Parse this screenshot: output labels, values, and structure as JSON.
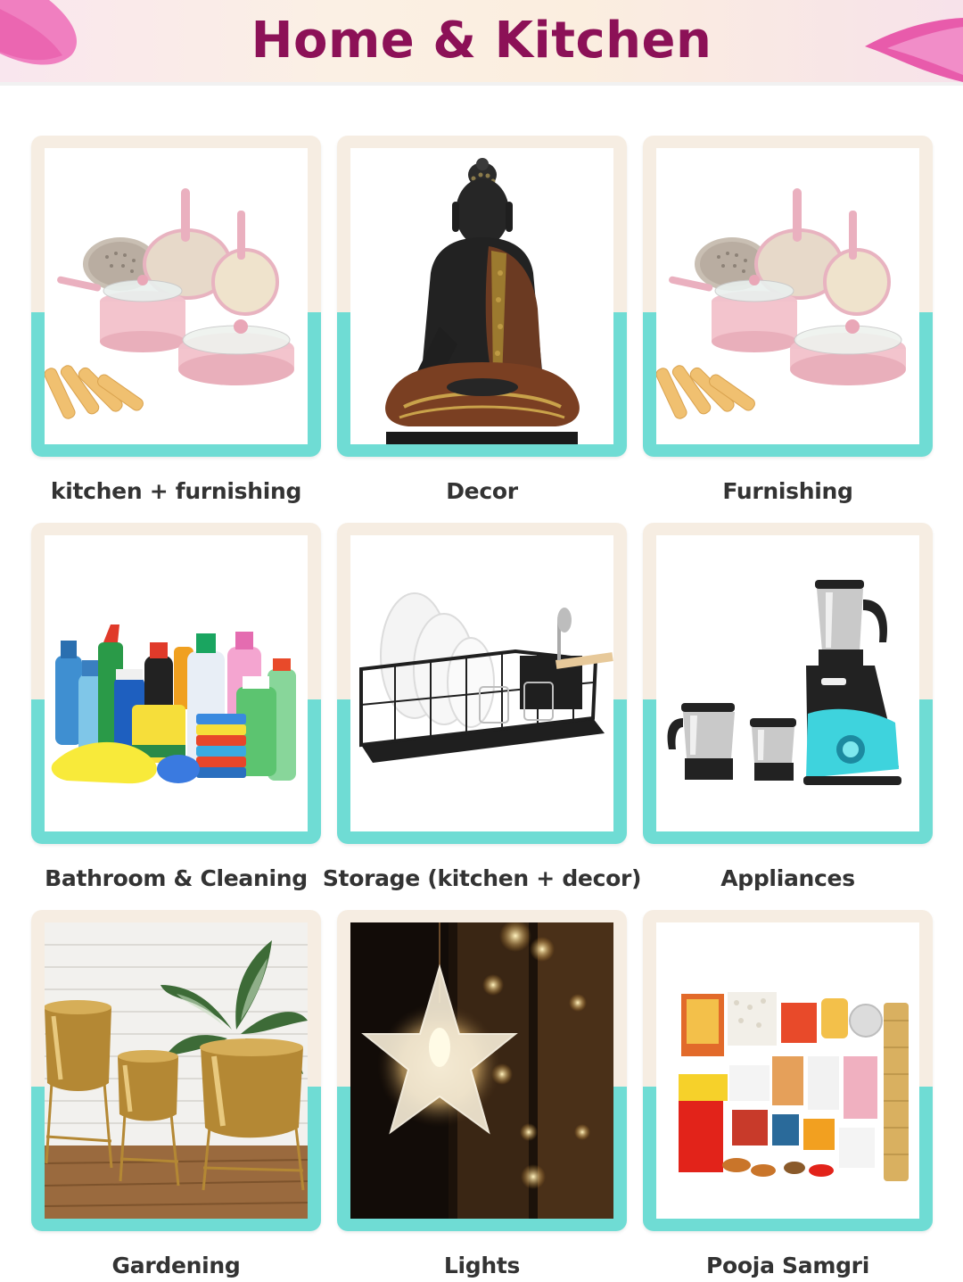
{
  "header": {
    "title": "Home & Kitchen"
  },
  "categories": [
    {
      "label": "kitchen + furnishing",
      "icon": "cookware-set-icon"
    },
    {
      "label": "Decor",
      "icon": "buddha-statue-icon"
    },
    {
      "label": "Furnishing",
      "icon": "cookware-set-icon"
    },
    {
      "label": "Bathroom & Cleaning",
      "icon": "cleaning-supplies-icon"
    },
    {
      "label": "Storage (kitchen + decor)",
      "icon": "dish-rack-icon"
    },
    {
      "label": "Appliances",
      "icon": "mixer-grinder-icon"
    },
    {
      "label": "Gardening",
      "icon": "planters-icon"
    },
    {
      "label": "Lights",
      "icon": "star-light-icon"
    },
    {
      "label": "Pooja Samgri",
      "icon": "pooja-kit-icon"
    }
  ],
  "colors": {
    "title": "#8c1157",
    "card_top": "#f6ede2",
    "card_bottom": "#6fdcd4",
    "label": "#333333"
  }
}
